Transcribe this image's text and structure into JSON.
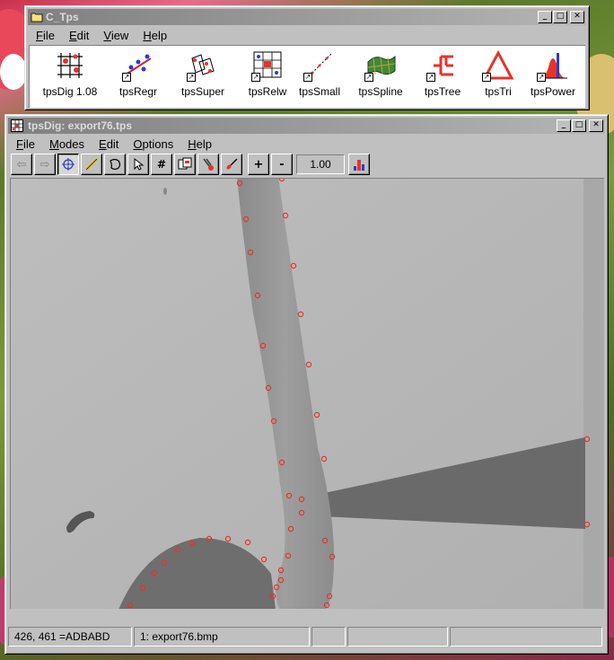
{
  "launcher": {
    "title": "C_Tps",
    "menus": [
      {
        "u": "F",
        "rest": "ile"
      },
      {
        "u": "E",
        "rest": "dit"
      },
      {
        "u": "V",
        "rest": "iew"
      },
      {
        "u": "H",
        "rest": "elp"
      }
    ],
    "apps": [
      "tpsDig 1.08",
      "tpsRegr",
      "tpsSuper",
      "tpsRelw",
      "tpsSmall",
      "tpsSpline",
      "tpsTree",
      "tpsTri",
      "tpsPower"
    ]
  },
  "dig": {
    "title": "tpsDig: export76.tps",
    "menus": [
      {
        "u": "F",
        "rest": "ile"
      },
      {
        "u": "M",
        "rest": "odes"
      },
      {
        "u": "E",
        "rest": "dit"
      },
      {
        "u": "O",
        "rest": "ptions"
      },
      {
        "u": "H",
        "rest": "elp"
      }
    ],
    "zoom": "1.00",
    "status": {
      "coords": "426, 461 =ADBABD",
      "file": "1: export76.bmp",
      "panel3": "",
      "panel4": "",
      "panel5": ""
    }
  },
  "icons": {
    "prev": "arrow-left-icon",
    "next": "arrow-right-icon",
    "digitize": "crosshair-icon",
    "measure": "ruler-icon",
    "outline": "outline-icon",
    "select": "pointer-icon",
    "number": "hash-icon",
    "copy": "copy-image-icon",
    "tweezers": "tweezers-icon",
    "brush": "brush-icon",
    "zoomIn": "plus-icon",
    "zoomOut": "minus-icon",
    "histogram": "histogram-icon"
  },
  "colors": {
    "landmark": "#e8322c",
    "title_inactive": "#808080",
    "face": "#c0c0c0"
  }
}
